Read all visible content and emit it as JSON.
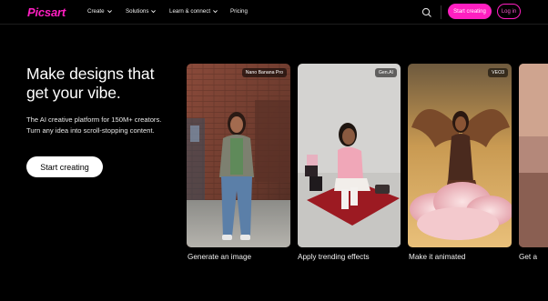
{
  "brand": {
    "logo": "Picsart",
    "accent": "#ff1fc1"
  },
  "nav": {
    "items": [
      {
        "label": "Create",
        "has_dropdown": true
      },
      {
        "label": "Solutions",
        "has_dropdown": true
      },
      {
        "label": "Learn & connect",
        "has_dropdown": true
      },
      {
        "label": "Pricing",
        "has_dropdown": false
      }
    ],
    "search_icon": "search-icon",
    "start_button": "Start creating",
    "login_button": "Log in"
  },
  "hero": {
    "headline": "Make designs that get your vibe.",
    "subtext": "The AI creative platform for 150M+ creators. Turn any idea into scroll-stopping content.",
    "cta": "Start creating"
  },
  "cards": [
    {
      "badge": "Nano Banana Pro",
      "label": "Generate an image"
    },
    {
      "badge": "Gen.AI",
      "label": "Apply trending effects"
    },
    {
      "badge": "VEO3",
      "label": "Make it animated"
    },
    {
      "badge": "",
      "label": "Get a"
    }
  ]
}
